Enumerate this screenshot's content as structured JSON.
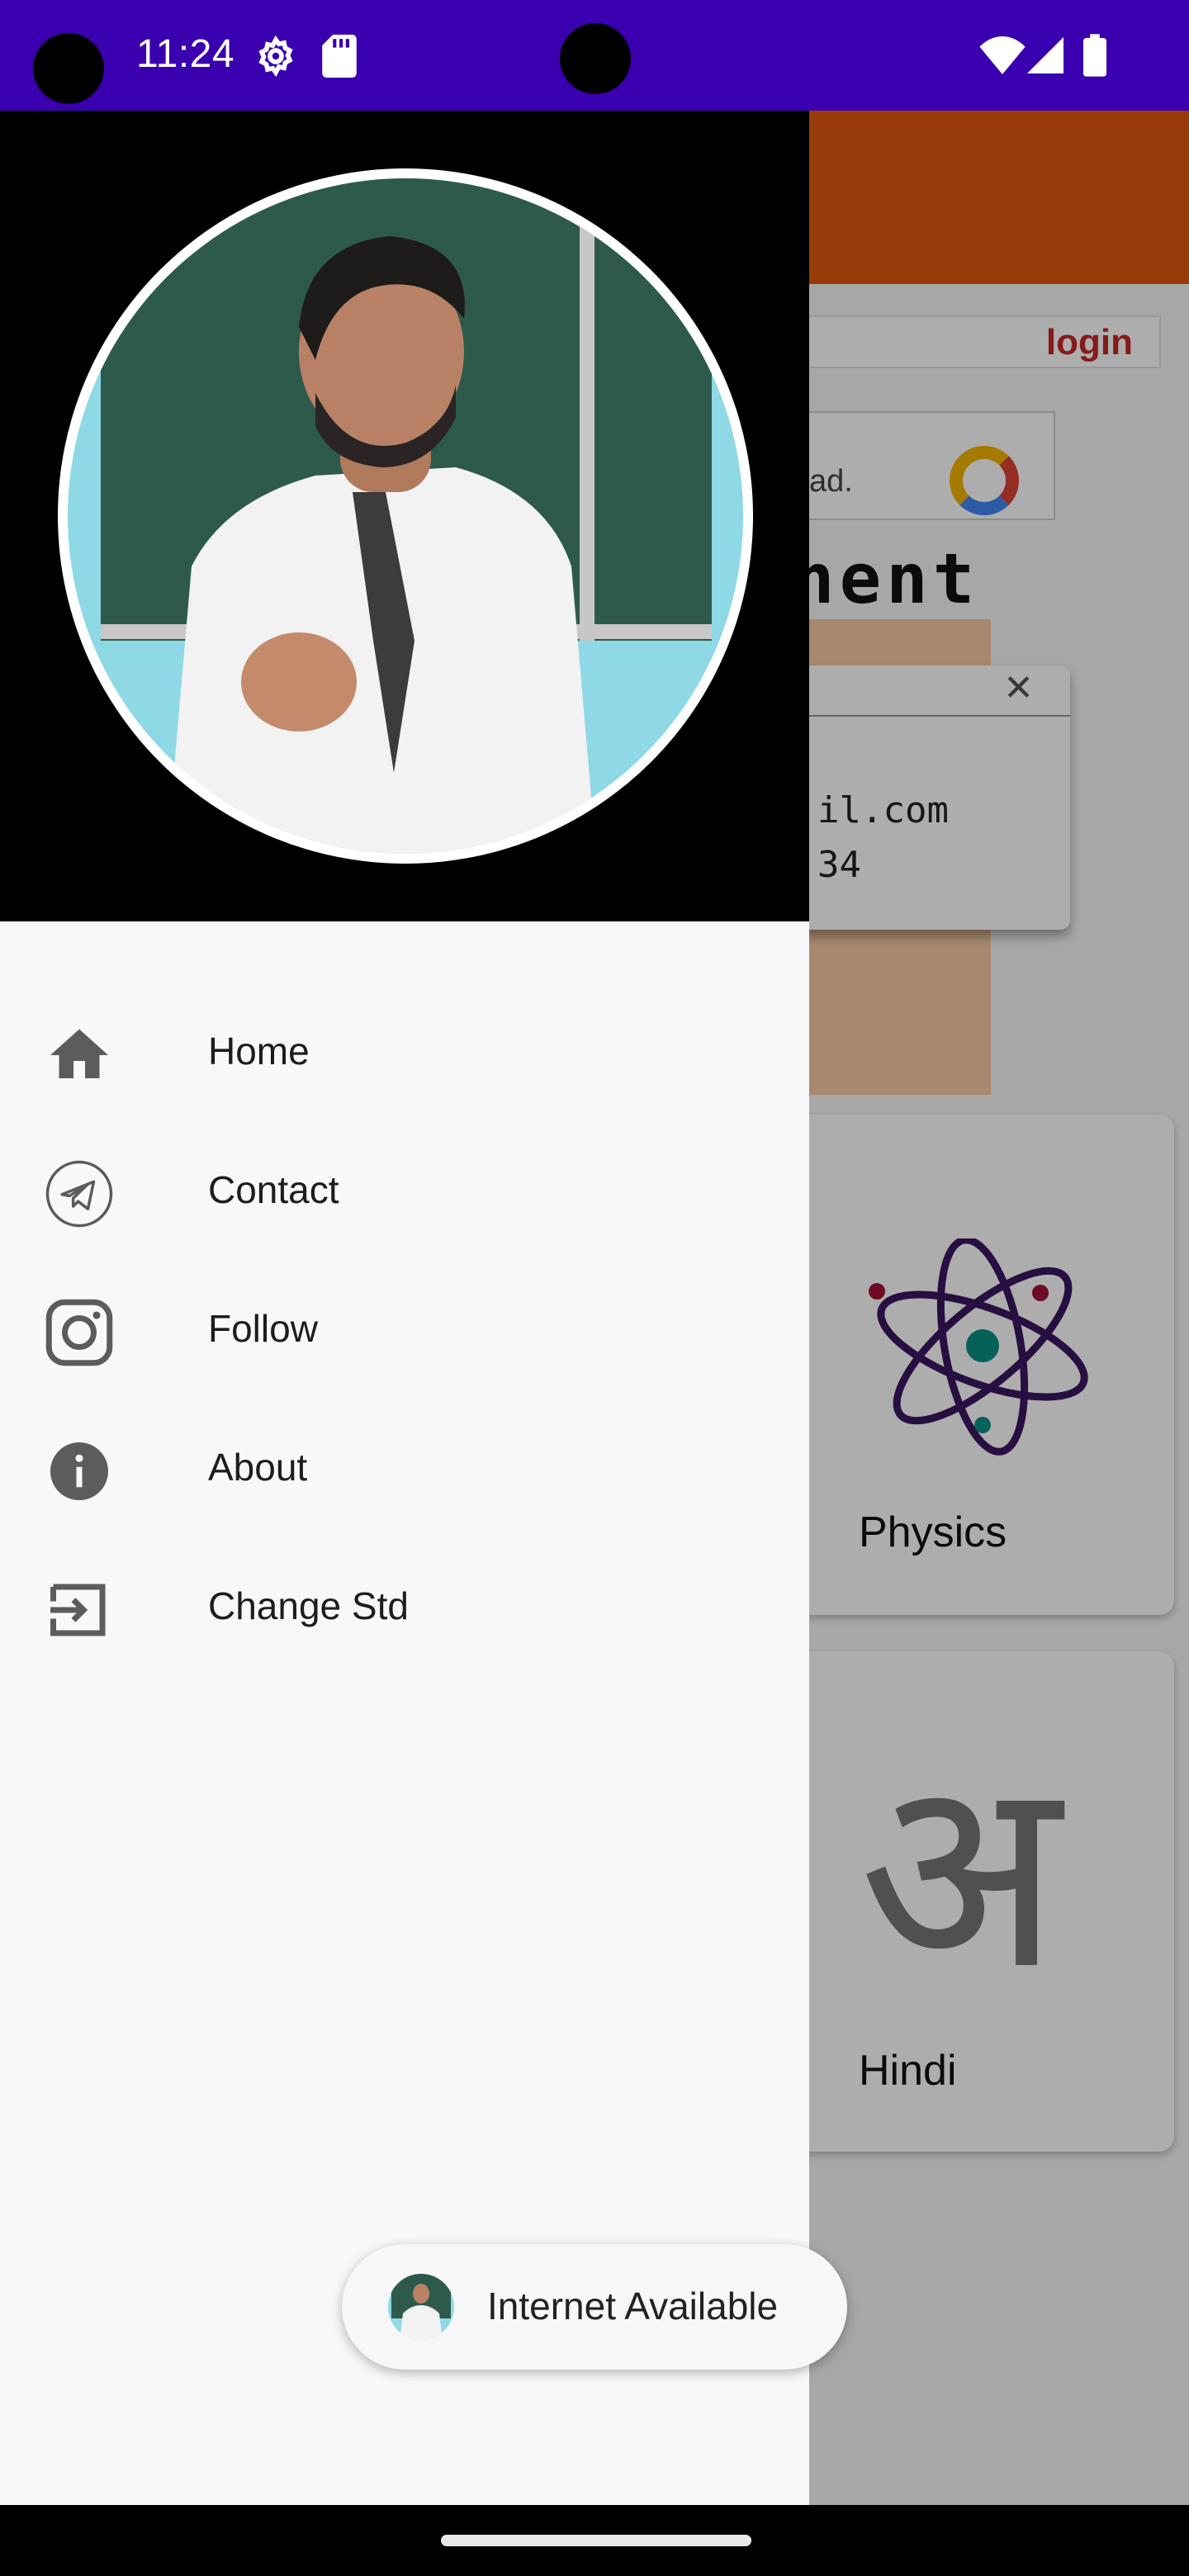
{
  "status_bar": {
    "time": "11:24",
    "icons": [
      "settings-gear-icon",
      "sd-card-icon",
      "wifi-icon",
      "signal-icon",
      "battery-icon"
    ],
    "background": "#3a00b0"
  },
  "background_screen": {
    "appbar_color": "#e0570e",
    "login_label": "login",
    "ad_text": "ad.",
    "heading_fragment": "nent",
    "popup": {
      "close_symbol": "✕",
      "email_fragment": "il.com",
      "phone_fragment": "34"
    },
    "cards": [
      {
        "label": "Physics",
        "icon": "atom-icon"
      },
      {
        "label": "Hindi",
        "icon": "hindi-letter-a-icon",
        "glyph": "अ"
      }
    ]
  },
  "drawer": {
    "header_background": "#000000",
    "menu": [
      {
        "label": "Home",
        "icon": "home-icon"
      },
      {
        "label": "Contact",
        "icon": "telegram-icon"
      },
      {
        "label": "Follow",
        "icon": "instagram-icon"
      },
      {
        "label": "About",
        "icon": "info-icon"
      },
      {
        "label": "Change Std",
        "icon": "exit-icon"
      }
    ]
  },
  "toast": {
    "text": "Internet Available"
  }
}
